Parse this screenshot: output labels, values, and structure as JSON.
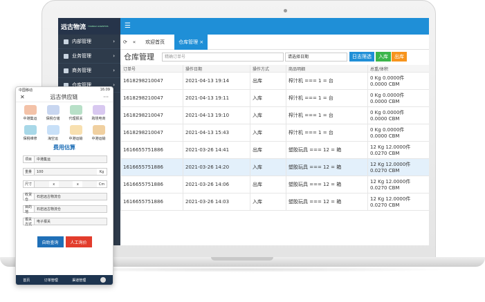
{
  "brand_logo": "远古物流",
  "brand_sub": "YUANGU LOGISTICS",
  "sidebar": {
    "items": [
      {
        "label": "内部管理"
      },
      {
        "label": "业务管理"
      },
      {
        "label": "商务管理"
      },
      {
        "label": "仓库管理"
      }
    ]
  },
  "topbar_menu": "☰",
  "tabs": {
    "home": "欢迎首页",
    "warehouse": "仓库管理",
    "close": "×"
  },
  "page_title": "仓库管理",
  "toolbar": {
    "search_placeholder": "精确订单号",
    "date_select": "请选择日期",
    "filter_btn": "日志筛选",
    "in_btn": "入库",
    "out_btn": "出库"
  },
  "table": {
    "headers": [
      "订单号",
      "操作日期",
      "操作方式",
      "商品明细",
      "总重/体积"
    ],
    "rows": [
      {
        "order": "1618298210047",
        "date": "2021-04-13 19:14",
        "op": "出库",
        "item": "榨汁机 === 1 = 台",
        "w": "0 Kg 0.0000件",
        "v": "0.0000 CBM"
      },
      {
        "order": "1618298210047",
        "date": "2021-04-13 19:11",
        "op": "入库",
        "item": "榨汁机 === 1 = 台",
        "w": "0 Kg 0.0000件",
        "v": "0.0000 CBM"
      },
      {
        "order": "1618298210047",
        "date": "2021-04-13 19:10",
        "op": "入库",
        "item": "榨汁机 === 1 = 台",
        "w": "0 Kg 0.0000件",
        "v": "0.0000 CBM"
      },
      {
        "order": "1618298210047",
        "date": "2021-04-13 15:43",
        "op": "入库",
        "item": "榨汁机 === 1 = 台",
        "w": "0 Kg 0.0000件",
        "v": "0.0000 CBM"
      },
      {
        "order": "1616655751886",
        "date": "2021-03-26 14:41",
        "op": "出库",
        "item": "塑胶玩具 === 12 = 箱",
        "w": "12 Kg 12.0000件",
        "v": "0.0270 CBM"
      },
      {
        "order": "1616655751886",
        "date": "2021-03-26 14:20",
        "op": "入库",
        "item": "塑胶玩具 === 12 = 箱",
        "w": "12 Kg 12.0000件",
        "v": "0.0270 CBM"
      },
      {
        "order": "1616655751886",
        "date": "2021-03-26 14:06",
        "op": "出库",
        "item": "塑胶玩具 === 12 = 箱",
        "w": "12 Kg 12.0000件",
        "v": "0.0270 CBM"
      },
      {
        "order": "1616655751886",
        "date": "2021-03-26 14:03",
        "op": "入库",
        "item": "塑胶玩具 === 12 = 箱",
        "w": "12 Kg 12.0000件",
        "v": "0.0270 CBM"
      }
    ]
  },
  "phone": {
    "carrier": "中国移动",
    "time": "16:09",
    "title": "远古供应链",
    "close": "✕",
    "more": "···",
    "services": [
      {
        "label": "中港集运",
        "color": "#f3c2a8"
      },
      {
        "label": "保税仓储",
        "color": "#c8d6f0"
      },
      {
        "label": "代理报关",
        "color": "#b8e0c8"
      },
      {
        "label": "跨境电商",
        "color": "#d8c8f0"
      },
      {
        "label": "保税维修",
        "color": "#a8d8e8"
      },
      {
        "label": "海空运",
        "color": "#c8e0f8"
      },
      {
        "label": "中港运输",
        "color": "#f8e0b0"
      },
      {
        "label": "中港运输",
        "color": "#f0d0a0"
      }
    ],
    "calc_title": "费用估算",
    "fields": {
      "route_k": "项目",
      "route_v": "中港集运",
      "weight_k": "重量",
      "weight_v": "100",
      "weight_u": "Kg",
      "size_k": "尺寸",
      "size_x1": "x",
      "size_x2": "x",
      "size_u": "Cm",
      "from_k": "收货仓",
      "from_v": "石岩远古物流仓",
      "to_k": "目的地",
      "to_v": "石岩远古物流仓",
      "decl_k": "报关方式",
      "decl_v": "电子报关"
    },
    "btn_auto": "自助查询",
    "btn_manual": "人工询价",
    "footer": {
      "home": "首页",
      "orders": "订单管理",
      "service": "渠道管理"
    }
  }
}
